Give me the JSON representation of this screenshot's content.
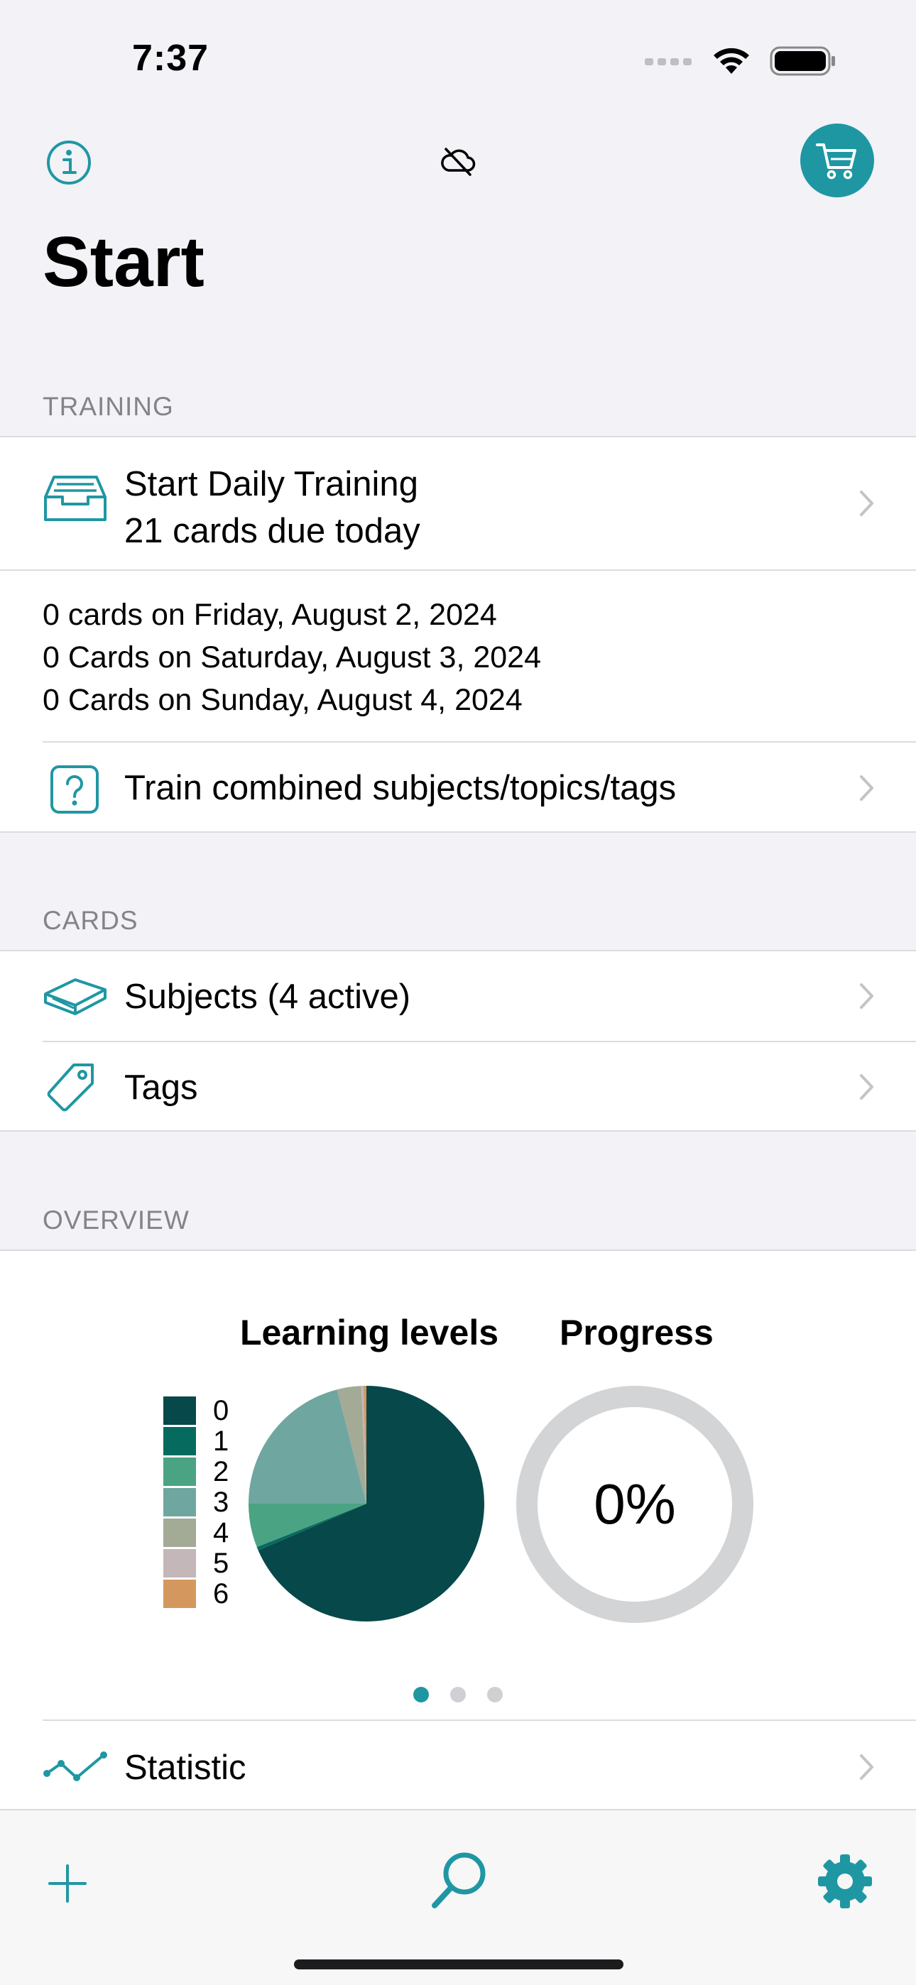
{
  "status": {
    "time": "7:37"
  },
  "nav": {
    "title": "Start"
  },
  "training": {
    "header": "TRAINING",
    "daily_title": "Start Daily Training",
    "daily_sub": "21 cards due today",
    "upcoming": [
      "0 cards on Friday, August 2, 2024",
      "0 Cards on Saturday, August 3, 2024",
      "0 Cards on Sunday, August 4, 2024"
    ],
    "combined_label": "Train combined subjects/topics/tags"
  },
  "cards": {
    "header": "CARDS",
    "subjects_label": "Subjects (4 active)",
    "tags_label": "Tags"
  },
  "overview": {
    "header": "OVERVIEW",
    "levels_title": "Learning levels",
    "progress_title": "Progress",
    "progress_value": "0%",
    "progress_fraction": 0,
    "legend": [
      {
        "label": "0",
        "color": "#07484a"
      },
      {
        "label": "1",
        "color": "#066b5e"
      },
      {
        "label": "2",
        "color": "#4aa382"
      },
      {
        "label": "3",
        "color": "#6fa7a0"
      },
      {
        "label": "4",
        "color": "#a3aa96"
      },
      {
        "label": "5",
        "color": "#c3b7b9"
      },
      {
        "label": "6",
        "color": "#d4985f"
      }
    ],
    "statistic_label": "Statistic"
  },
  "chart_data": {
    "type": "pie",
    "categories": [
      "0",
      "1",
      "2",
      "3",
      "4",
      "5",
      "6"
    ],
    "values": [
      68.5,
      0.5,
      6,
      21,
      3.3,
      0.3,
      0.4
    ],
    "title": "Learning levels",
    "legend": "left"
  },
  "colors": {
    "accent": "#1f97a3"
  }
}
